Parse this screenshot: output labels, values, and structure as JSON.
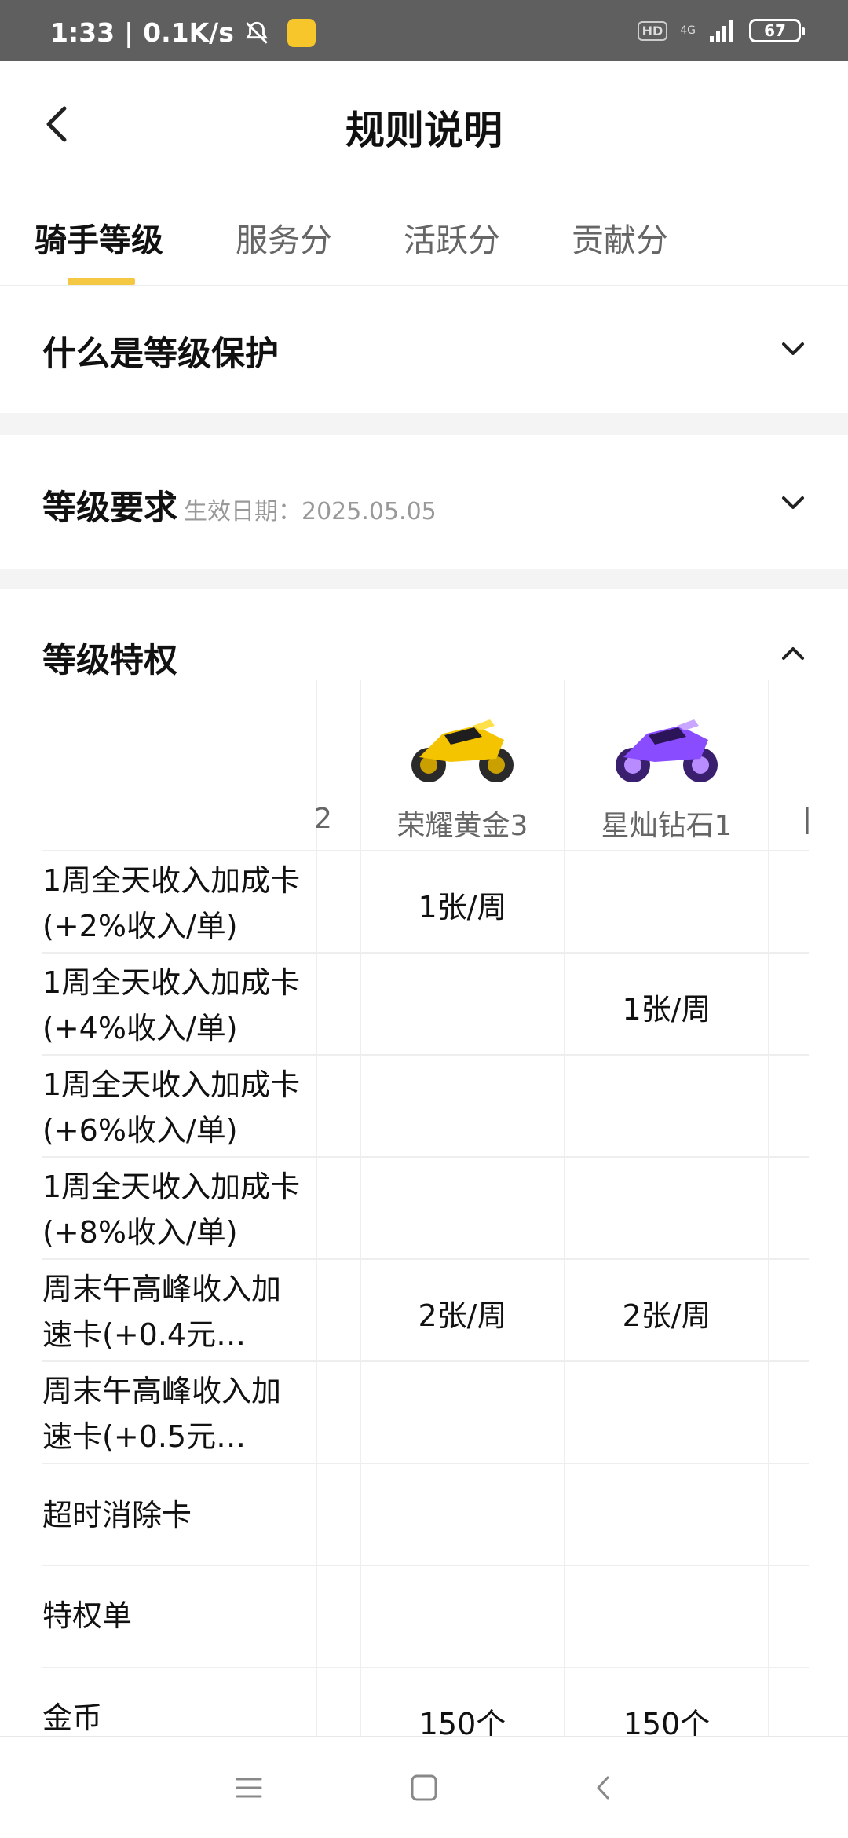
{
  "status": {
    "time": "1:33",
    "speed": "0.1K/s",
    "hd": "HD",
    "network": "4G",
    "battery": "67"
  },
  "header": {
    "title": "规则说明"
  },
  "tabs": [
    {
      "label": "骑手等级",
      "active": true
    },
    {
      "label": "服务分",
      "active": false
    },
    {
      "label": "活跃分",
      "active": false
    },
    {
      "label": "贡献分",
      "active": false
    }
  ],
  "sections": {
    "protection": {
      "title": "什么是等级保护"
    },
    "requirements": {
      "title": "等级要求",
      "subtitle": "生效日期：2025.05.05"
    },
    "privileges": {
      "title": "等级特权"
    }
  },
  "table": {
    "partial_left_column_fragment": "2",
    "columns": [
      {
        "name": "荣耀黄金3",
        "bike_color": "#f5c400"
      },
      {
        "name": "星灿钻石1",
        "bike_color": "#8a4cff"
      }
    ],
    "rows": [
      {
        "label": "1周全天收入加成卡(+2%收入/单)",
        "values": [
          "1张/周",
          ""
        ]
      },
      {
        "label": "1周全天收入加成卡(+4%收入/单)",
        "values": [
          "",
          "1张/周"
        ]
      },
      {
        "label": "1周全天收入加成卡(+6%收入/单)",
        "values": [
          "",
          ""
        ]
      },
      {
        "label": "1周全天收入加成卡(+8%收入/单)",
        "values": [
          "",
          ""
        ]
      },
      {
        "label": "周末午高峰收入加速卡(+0.4元…",
        "values": [
          "2张/周",
          "2张/周"
        ]
      },
      {
        "label": "周末午高峰收入加速卡(+0.5元…",
        "values": [
          "",
          ""
        ]
      },
      {
        "label": "超时消除卡",
        "values": [
          "",
          ""
        ]
      },
      {
        "label": "特权单",
        "values": [
          "",
          ""
        ]
      },
      {
        "label": "金币",
        "values": [
          "150个",
          "150个"
        ]
      }
    ]
  },
  "colors": {
    "accent": "#f5c843",
    "status_bar": "#5f5f5f",
    "section_gap": "#f4f4f4"
  },
  "nav": [
    "menu-icon",
    "home-icon",
    "back-icon"
  ]
}
